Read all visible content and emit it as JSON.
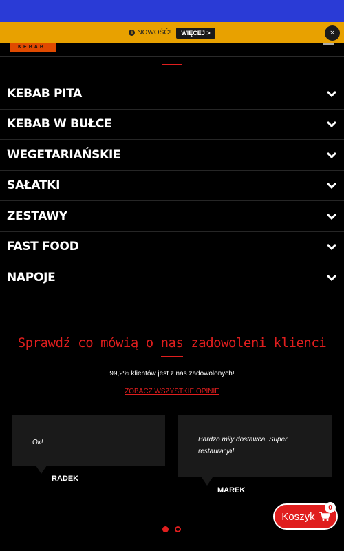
{
  "notice": {
    "text": "NOWOŚĆ!",
    "more_label": "WIĘCEJ >",
    "close_label": "×"
  },
  "logo": {
    "text": "KEBAB"
  },
  "menu": {
    "items": [
      {
        "label": "KEBAB PITA"
      },
      {
        "label": "KEBAB W BUŁCE"
      },
      {
        "label": "WEGETARIAŃSKIE"
      },
      {
        "label": "SAŁATKI"
      },
      {
        "label": "ZESTAWY"
      },
      {
        "label": "FAST FOOD"
      },
      {
        "label": "NAPOJE"
      }
    ]
  },
  "reviews": {
    "title": "Sprawdź co mówią o nas zadowoleni klienci",
    "subtitle": "99,2% klientów jest z nas zadowolonych!",
    "all_link": "ZOBACZ WSZYSTKIE OPINIE",
    "items": [
      {
        "quote": "Ok!",
        "author": "RADEK"
      },
      {
        "quote": "Bardzo miły dostawca. Super restauracja!",
        "author": "MAREK"
      }
    ],
    "active_dot": 1
  },
  "cart": {
    "label": "Koszyk",
    "count": "0"
  },
  "colors": {
    "accent": "#e01e1e",
    "notice_bg": "#e8a100",
    "topbar": "#2a3bd6"
  }
}
